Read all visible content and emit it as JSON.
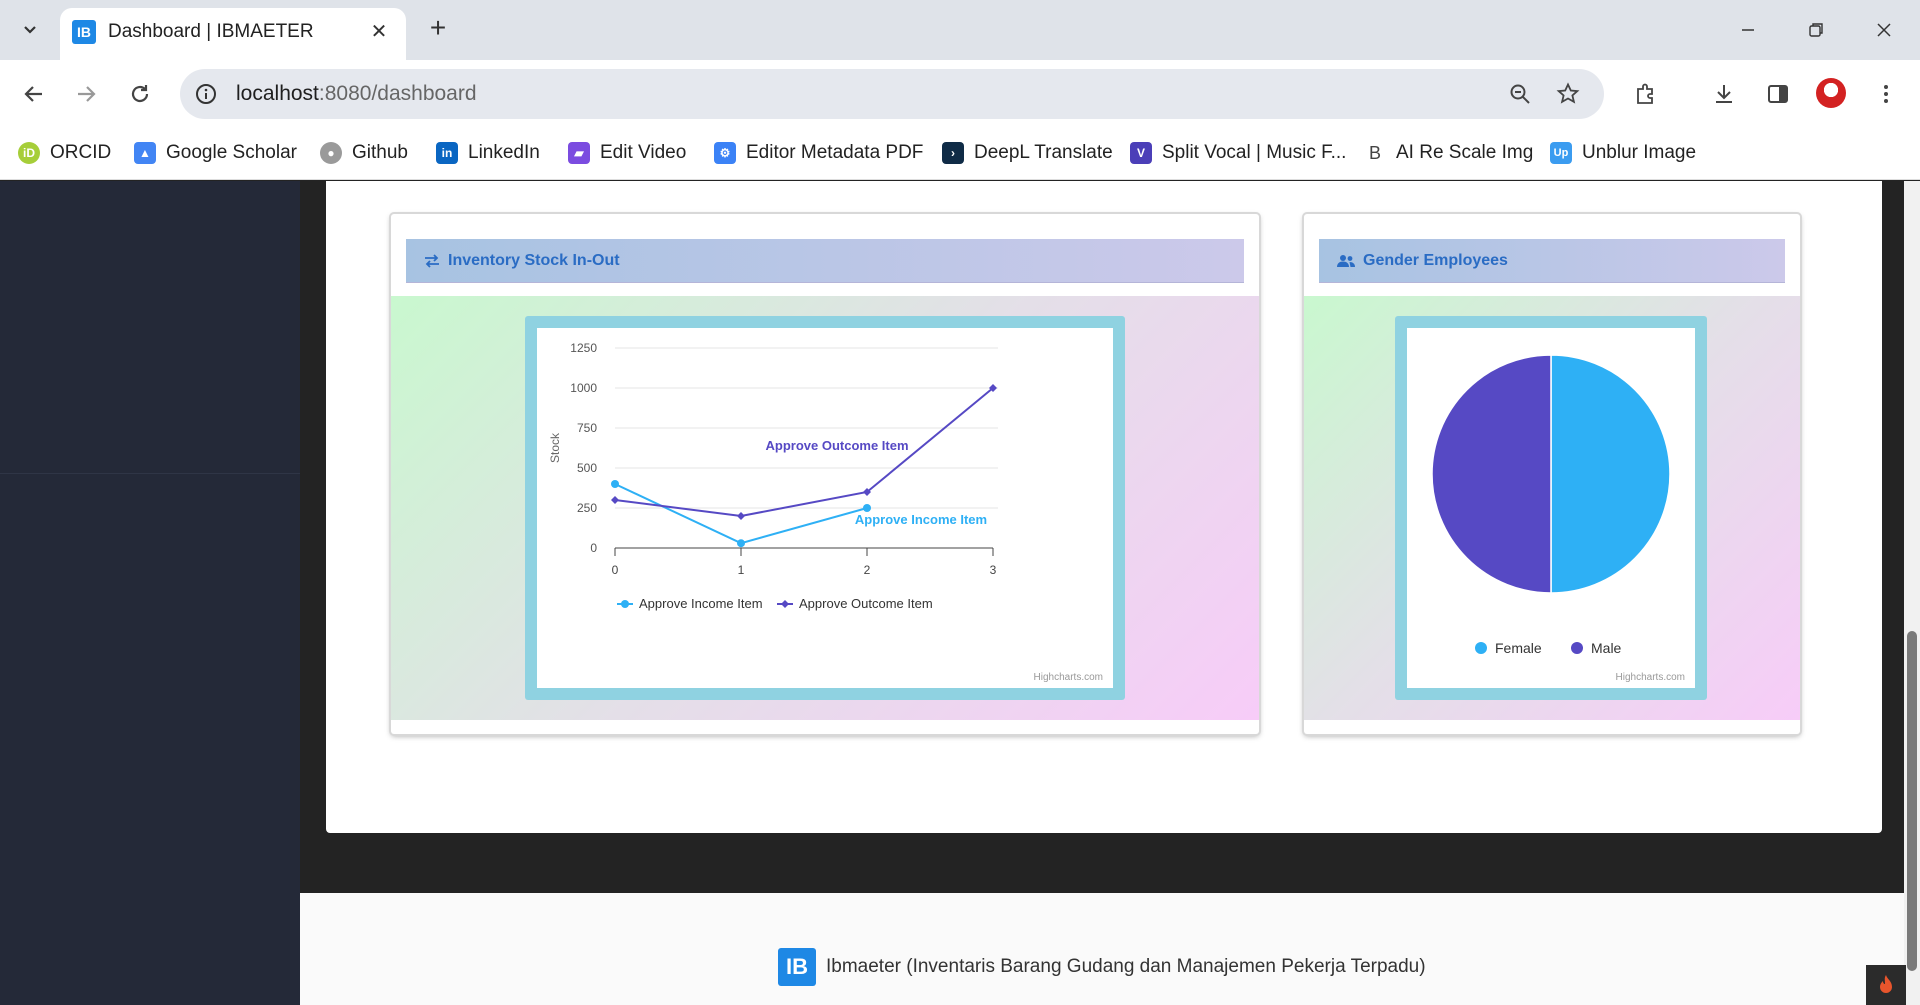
{
  "browser": {
    "tab_title": "Dashboard | IBMAETER",
    "favicon_text": "IB",
    "url_host": "localhost",
    "url_path": ":8080/dashboard"
  },
  "bookmarks": [
    {
      "label": "ORCID",
      "icon": "orcid-icon",
      "color": "#a6ce39",
      "glyph": "iD"
    },
    {
      "label": "Google Scholar",
      "icon": "google-scholar-icon",
      "color": "#4285f4",
      "glyph": "▲"
    },
    {
      "label": "Github",
      "icon": "github-icon",
      "color": "#999999",
      "glyph": "●"
    },
    {
      "label": "LinkedIn",
      "icon": "linkedin-icon",
      "color": "#0a66c2",
      "glyph": "in"
    },
    {
      "label": "Edit Video",
      "icon": "edit-video-icon",
      "color": "#7b4ce0",
      "glyph": "▰"
    },
    {
      "label": "Editor Metadata PDF",
      "icon": "pdf-metadata-icon",
      "color": "#3b82f6",
      "glyph": "⚙"
    },
    {
      "label": "DeepL Translate",
      "icon": "deepl-icon",
      "color": "#0f2b46",
      "glyph": "›"
    },
    {
      "label": "Split Vocal | Music F...",
      "icon": "split-vocal-icon",
      "color": "#4b3fb8",
      "glyph": "V"
    },
    {
      "label": "AI Re Scale Img",
      "icon": "ai-rescale-icon",
      "color": "#ffffff",
      "glyph": "B"
    },
    {
      "label": "Unblur Image",
      "icon": "unblur-icon",
      "color": "#3b9cf0",
      "glyph": "Up"
    }
  ],
  "inventory_panel": {
    "title": "Inventory Stock In-Out",
    "icon": "exchange-icon"
  },
  "gender_panel": {
    "title": "Gender Employees",
    "icon": "users-icon"
  },
  "chart_data": [
    {
      "type": "line",
      "title": "",
      "ylabel": "Stock",
      "xlabel": "",
      "x": [
        0,
        1,
        2,
        3
      ],
      "ylim": [
        0,
        1250
      ],
      "yticks": [
        0,
        250,
        500,
        750,
        1000,
        1250
      ],
      "grid": true,
      "legend": "bottom",
      "series": [
        {
          "name": "Approve Income Item",
          "x": [
            0,
            1,
            2
          ],
          "values": [
            400,
            30,
            250
          ],
          "color": "#2eb0f5",
          "marker": "circle"
        },
        {
          "name": "Approve Outcome Item",
          "x": [
            0,
            1,
            2,
            3
          ],
          "values": [
            300,
            200,
            350,
            1000
          ],
          "color": "#5649c4",
          "marker": "diamond"
        }
      ],
      "annotations": [
        "Approve Outcome Item",
        "Approve Income Item"
      ],
      "credits": "Highcharts.com"
    },
    {
      "type": "pie",
      "title": "",
      "legend": "bottom",
      "slices": [
        {
          "name": "Female",
          "value": 50,
          "color": "#2eb0f5"
        },
        {
          "name": "Male",
          "value": 50,
          "color": "#5649c4"
        }
      ],
      "credits": "Highcharts.com"
    }
  ],
  "footer": {
    "logo_text": "IB",
    "text": "Ibmaeter (Inventaris Barang Gudang dan Manajemen Pekerja Terpadu)"
  }
}
